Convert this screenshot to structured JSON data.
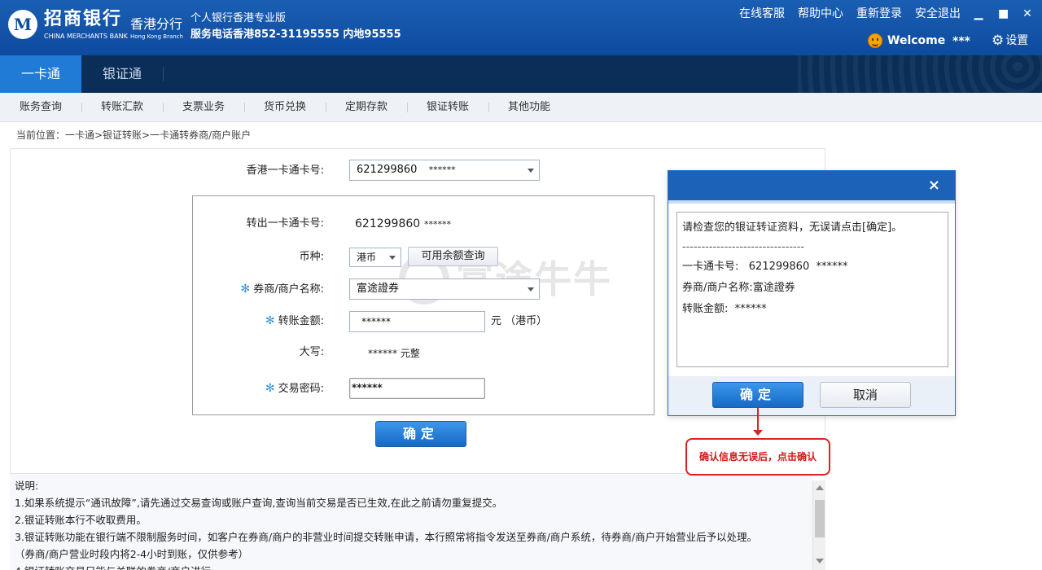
{
  "header": {
    "bank_name_cn": "招商银行",
    "bank_name_en": "CHINA MERCHANTS BANK",
    "branch_cn": "香港分行",
    "branch_en": "Hong Kong Branch",
    "slogan": "个人银行香港专业版",
    "hotline": "服务电话香港852-31195555 内地95555",
    "links": [
      "在线客服",
      "帮助中心",
      "重新登录",
      "安全退出"
    ],
    "welcome": "Welcome",
    "username": "***",
    "settings": "设置"
  },
  "main_tabs": [
    {
      "label": "一卡通",
      "active": true
    },
    {
      "label": "银证通",
      "active": false
    }
  ],
  "sub_nav": [
    "账务查询",
    "转账汇款",
    "支票业务",
    "货币兑换",
    "定期存款",
    "银证转账",
    "其他功能"
  ],
  "breadcrumb": "当前位置：一卡通>银证转账>一卡通转券商/商户账户",
  "form": {
    "card_label": "香港一卡通卡号:",
    "card_number": "621299860",
    "card_mask": "******",
    "out_card_label": "转出一卡通卡号:",
    "out_card_number": "621299860",
    "out_card_mask": "******",
    "currency_label": "币种:",
    "currency_value": "港币",
    "balance_button": "可用余额查询",
    "broker_label": "券商/商户名称:",
    "broker_value": "富途證券",
    "amount_label": "转账金额:",
    "amount_value": "******",
    "amount_unit": "元 （港币）",
    "capital_label": "大写:",
    "capital_value": "****** 元整",
    "password_label": "交易密码:",
    "password_value": "******",
    "confirm_button": "确定",
    "required_mark": "✻"
  },
  "watermark": "富途牛牛",
  "notes": {
    "title": "说明:",
    "lines": [
      "1.如果系统提示“通讯故障”,请先通过交易查询或账户查询,查询当前交易是否已生效,在此之前请勿重复提交。",
      "2.银证转账本行不收取费用。",
      "3.银证转账功能在银行端不限制服务时间，如客户在券商/商户的非营业时间提交转账申请，本行照常将指令发送至券商/商户系统，待券商/商户开始营业后予以处理。",
      "（券商/商户营业时段内将2-4小时到账，仅供参考）",
      "4.银证转账交易只能与关联的券商/商户进行。"
    ]
  },
  "dialog": {
    "close": "×",
    "message": "请检查您的银证转证资料，无误请点击[确定]。",
    "divider": "--------------------------------",
    "card_line": "一卡通卡号:   621299860  ******",
    "broker_line": "券商/商户名称:富途證券",
    "amount_line": "转账金额:  ******",
    "ok_button": "确定",
    "cancel_button": "取消"
  },
  "annotation": "确认信息无误后，点击确认",
  "colors": {
    "header_blue": "#1a5fb4",
    "nav_dark": "#0a2e57",
    "tab_active": "#1f7bd6",
    "button_blue": "#1669c4",
    "required_mark": "#3a92d8",
    "annotation_red": "#e02020"
  }
}
